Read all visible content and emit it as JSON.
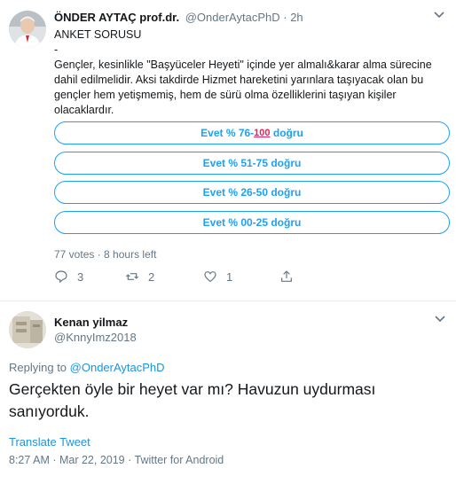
{
  "tweet1": {
    "author_name": "ÖNDER AYTAÇ prof.dr.",
    "author_handle": "@OnderAytacPhD",
    "separator": " · ",
    "time_ago": "2h",
    "line_title": "ANKET SORUSU",
    "line_dash": "-",
    "body_line1": "Gençler, kesinlikle \"Başyüceler Heyeti\" içinde yer almalı&karar alma sürecine",
    "body_line2": "dahil edilmelidir. Aksi takdirde Hizmet hareketini yarınlara taşıyacak olan bu",
    "body_line3": "gençler hem yetişmemiş, hem de sürü olma özelliklerini taşıyan kişiler",
    "body_line4": "olacaklardır.",
    "poll_options": [
      {
        "label": "Evet % 76-",
        "emoji": "100",
        "suffix": " doğru"
      },
      {
        "label": "Evet % 51-75 doğru"
      },
      {
        "label": "Evet % 26-50 doğru"
      },
      {
        "label": "Evet % 00-25 doğru"
      }
    ],
    "poll_votes": "77 votes",
    "poll_time_left": "8 hours left",
    "reply_count": "3",
    "retweet_count": "2",
    "like_count": "1",
    "icons": [
      "reply-icon",
      "retweet-icon",
      "heart-icon",
      "share-icon",
      "chevron-down-icon"
    ]
  },
  "tweet2": {
    "author_name": "Kenan yilmaz",
    "author_handle": "@KnnyImz2018",
    "replying_prefix": "Replying to ",
    "replying_handle": "@OnderAytacPhD",
    "body_line1": "Gerçekten öyle bir heyet var mı? Havuzun uydurması",
    "body_line2": "sanıyorduk.",
    "translate_label": "Translate Tweet",
    "timestamp": "8:27 AM · Mar 22, 2019 · ",
    "source": "Twitter for Android"
  },
  "colors": {
    "accent": "#1da1f2",
    "link": "#1b95e0",
    "muted": "#657786",
    "text": "#14171a",
    "divider": "#e6ecf0"
  }
}
